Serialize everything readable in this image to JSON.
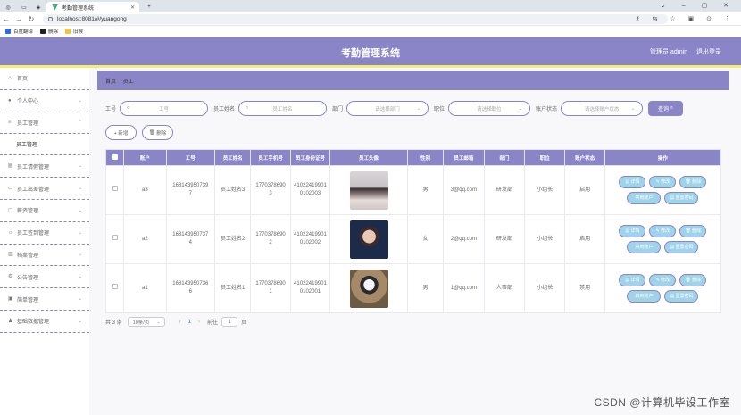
{
  "browser": {
    "tab_title": "考勤管理系统",
    "url": "localhost:8081/#/yuangong",
    "bookmarks": [
      {
        "label": "百度翻译",
        "color": "#2b6de0"
      },
      {
        "label": "删除",
        "color": "#222222"
      },
      {
        "label": "旧猴",
        "color": "#f3c338"
      }
    ]
  },
  "header": {
    "title": "考勤管理系统",
    "user": "管理员 admin",
    "logout": "退出登录",
    "color": "#8a85c7",
    "strip_color": "#f3ee73"
  },
  "sidebar": {
    "items": [
      {
        "label": "首页",
        "icon": "home-icon"
      },
      {
        "label": "个人中心",
        "icon": "user-icon"
      },
      {
        "label": "员工管理",
        "icon": "list-icon"
      },
      {
        "label": "员工管理",
        "sub": true
      },
      {
        "label": "员工请假管理",
        "icon": "chart-icon"
      },
      {
        "label": "员工出差管理",
        "icon": "monitor-icon"
      },
      {
        "label": "薪资管理",
        "icon": "chat-icon"
      },
      {
        "label": "员工签到管理",
        "icon": "sun-icon"
      },
      {
        "label": "档案管理",
        "icon": "folder-icon"
      },
      {
        "label": "公告管理",
        "icon": "gear-icon"
      },
      {
        "label": "简单管理",
        "icon": "box-icon"
      },
      {
        "label": "基础数据管理",
        "icon": "person-icon"
      }
    ]
  },
  "breadcrumb": {
    "home": "首页",
    "sep": "/",
    "current": "员工"
  },
  "search": {
    "gonghao_label": "工号",
    "gonghao_placeholder": "工号",
    "name_label": "员工姓名",
    "name_placeholder": "员工姓名",
    "dept_label": "部门",
    "dept_placeholder": "请选择部门",
    "pos_label": "职位",
    "pos_placeholder": "请选择职位",
    "status_label": "账户状态",
    "status_placeholder": "请选择账户状态",
    "query_label": "查询"
  },
  "ops": {
    "add_label": "+ 新增",
    "delete_label": "删除"
  },
  "table": {
    "headers": [
      "账户",
      "工号",
      "员工姓名",
      "员工手机号",
      "员工身份证号",
      "员工头像",
      "性别",
      "员工邮箱",
      "部门",
      "职位",
      "账户状态",
      "操作"
    ],
    "rows": [
      {
        "account": "a3",
        "gonghao": "1681439507397",
        "name": "员工姓名3",
        "phone": "17703786903",
        "idcard": "410224199010102003",
        "avatar": "av1",
        "gender": "男",
        "email": "3@qq.com",
        "dept": "研发部",
        "position": "小组长",
        "status": "启用",
        "b1": "详情",
        "b2": "修改",
        "b3": "删除",
        "b4": "禁用账户",
        "b5": "重置密码"
      },
      {
        "account": "a2",
        "gonghao": "1681439507374",
        "name": "员工姓名2",
        "phone": "17703786902",
        "idcard": "410224199010102002",
        "avatar": "av2",
        "gender": "女",
        "email": "2@qq.com",
        "dept": "研发部",
        "position": "小组长",
        "status": "启用",
        "b1": "详情",
        "b2": "修改",
        "b3": "删除",
        "b4": "禁用账户",
        "b5": "重置密码"
      },
      {
        "account": "a1",
        "gonghao": "1681439507366",
        "name": "员工姓名1",
        "phone": "17703786901",
        "idcard": "410224199010102001",
        "avatar": "av3",
        "gender": "男",
        "email": "1@qq.com",
        "dept": "人事部",
        "position": "小组长",
        "status": "禁用",
        "b1": "详情",
        "b2": "修改",
        "b3": "删除",
        "b4": "启用账户",
        "b5": "重置密码"
      }
    ]
  },
  "pager": {
    "total": "共 3 条",
    "per_page": "10条/页",
    "current": "1",
    "goto_label": "前往",
    "goto_value": "1",
    "page_unit": "页"
  },
  "watermark": "CSDN @计算机毕设工作室"
}
